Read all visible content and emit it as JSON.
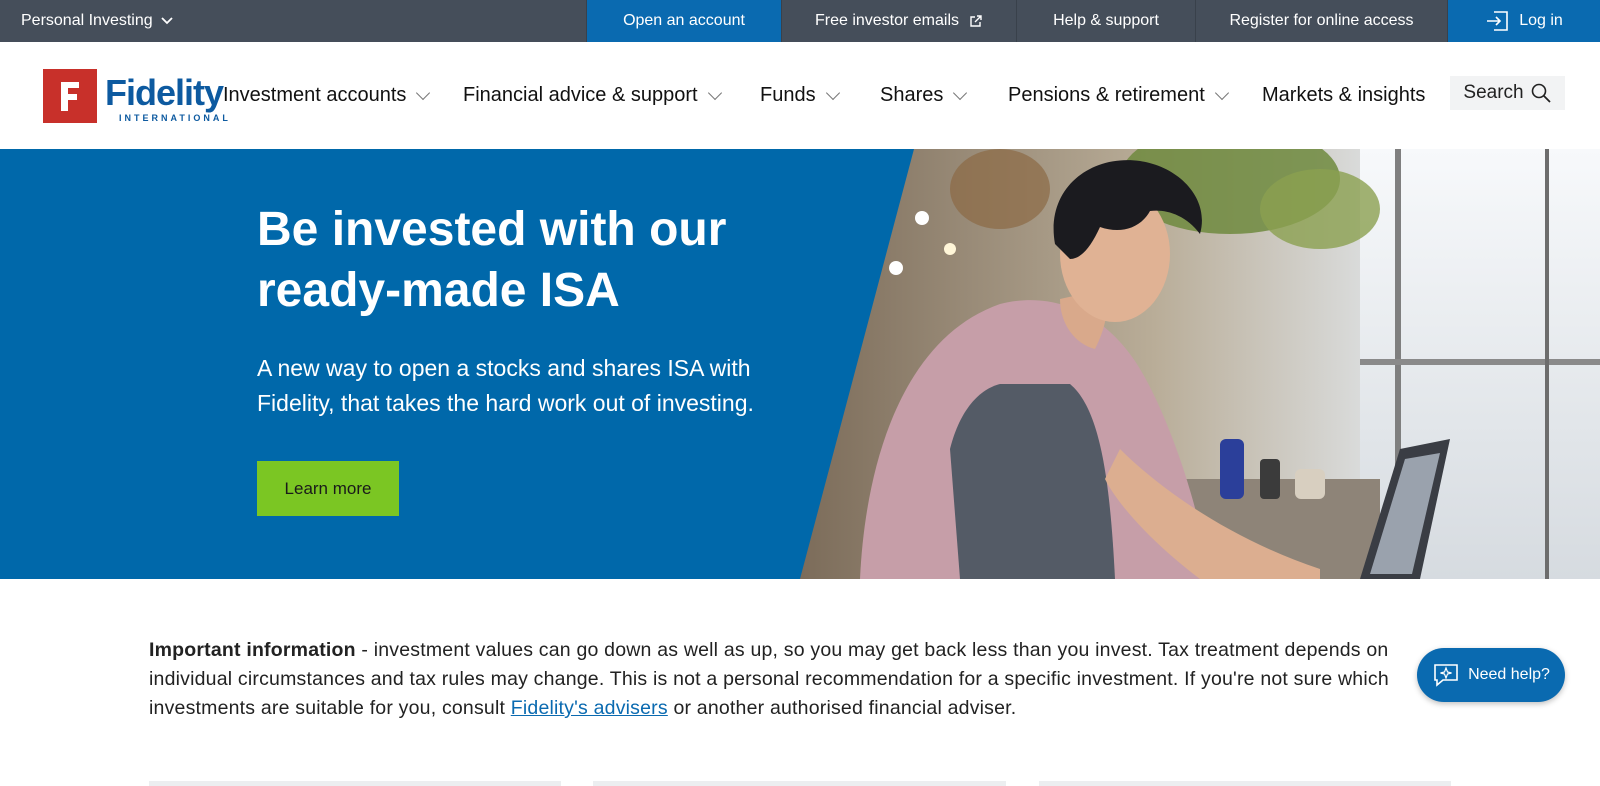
{
  "topbar": {
    "personal_label": "Personal Investing",
    "open_account": "Open an account",
    "free_emails": "Free investor emails",
    "help": "Help & support",
    "register": "Register for online access",
    "login": "Log in"
  },
  "logo": {
    "brand": "Fidelity",
    "sub": "INTERNATIONAL"
  },
  "nav": {
    "items": [
      {
        "label": "Investment accounts"
      },
      {
        "label": "Financial advice & support"
      },
      {
        "label": "Funds"
      },
      {
        "label": "Shares"
      },
      {
        "label": "Pensions & retirement"
      },
      {
        "label": "Markets & insights"
      }
    ],
    "search": "Search"
  },
  "hero": {
    "title": "Be invested with our ready-made ISA",
    "subtitle": "A new way to open a stocks and shares ISA with Fidelity, that takes the hard work out of investing.",
    "button": "Learn more"
  },
  "info": {
    "heading": "Important information",
    "text_before": " - investment values can go down as well as up, so you may get back less than you invest. Tax treatment depends on individual circumstances and tax rules may change. This is not a personal recommendation for a specific investment. If you're not sure which investments are suitable for you, consult ",
    "link": "Fidelity's advisers",
    "text_after": " or another authorised financial adviser."
  },
  "help_button": "Need help?",
  "colors": {
    "brand_blue": "#0068aa",
    "topbar": "#454e5a",
    "cta_green": "#7bc623",
    "logo_red": "#c8302a"
  }
}
